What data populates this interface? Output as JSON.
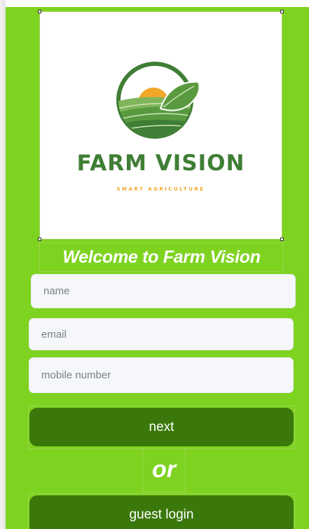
{
  "logo": {
    "brand_name": "FARM VISION",
    "tagline": "SMART AGRICULTURE",
    "icon": "farm-field-sun-leaf-icon"
  },
  "welcome_text": "Welcome to Farm Vision",
  "form": {
    "name_placeholder": "name",
    "email_placeholder": "email",
    "mobile_placeholder": "mobile number"
  },
  "buttons": {
    "next_label": "next",
    "or_text": "or",
    "guest_label": "guest login"
  },
  "colors": {
    "background": "#7ed321",
    "button": "#3a780b",
    "brand_green": "#3f7e35",
    "sun": "#f2a72a",
    "input_bg": "#f5f7fa"
  }
}
